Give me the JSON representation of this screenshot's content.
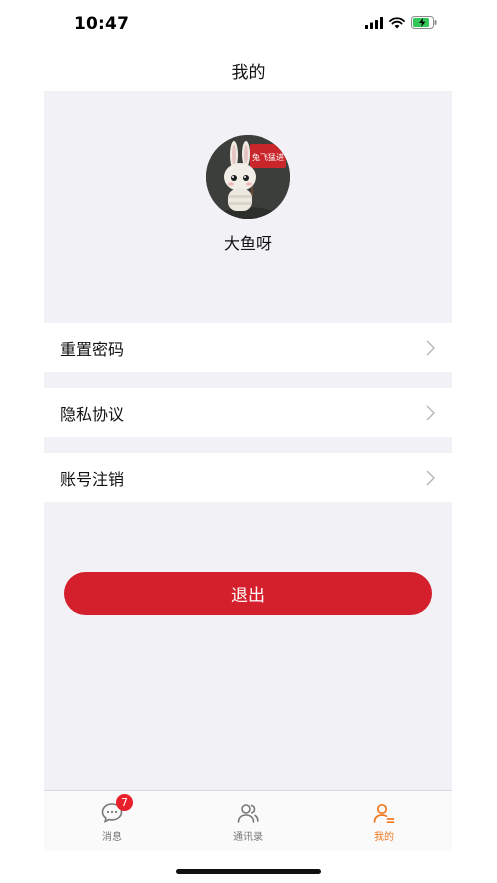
{
  "status_bar": {
    "time": "10:47"
  },
  "header": {
    "title": "我的"
  },
  "profile": {
    "username": "大鱼呀",
    "avatar_sign_text": "兔飞猛进"
  },
  "menu": [
    {
      "label": "重置密码",
      "icon": "chevron-right-icon"
    },
    {
      "label": "隐私协议",
      "icon": "chevron-right-icon"
    },
    {
      "label": "账号注销",
      "icon": "chevron-right-icon"
    }
  ],
  "logout": {
    "label": "退出"
  },
  "tabbar": {
    "tabs": [
      {
        "label": "消息",
        "icon": "chat-bubble-icon",
        "badge": "7"
      },
      {
        "label": "通讯录",
        "icon": "contacts-icon"
      },
      {
        "label": "我的",
        "icon": "profile-icon",
        "active": true
      }
    ],
    "active_color": "#f07820",
    "inactive_color": "#777777"
  },
  "colors": {
    "accent_red": "#d4202d",
    "background_gray": "#f2f2f6",
    "badge_red": "#e8202b"
  }
}
